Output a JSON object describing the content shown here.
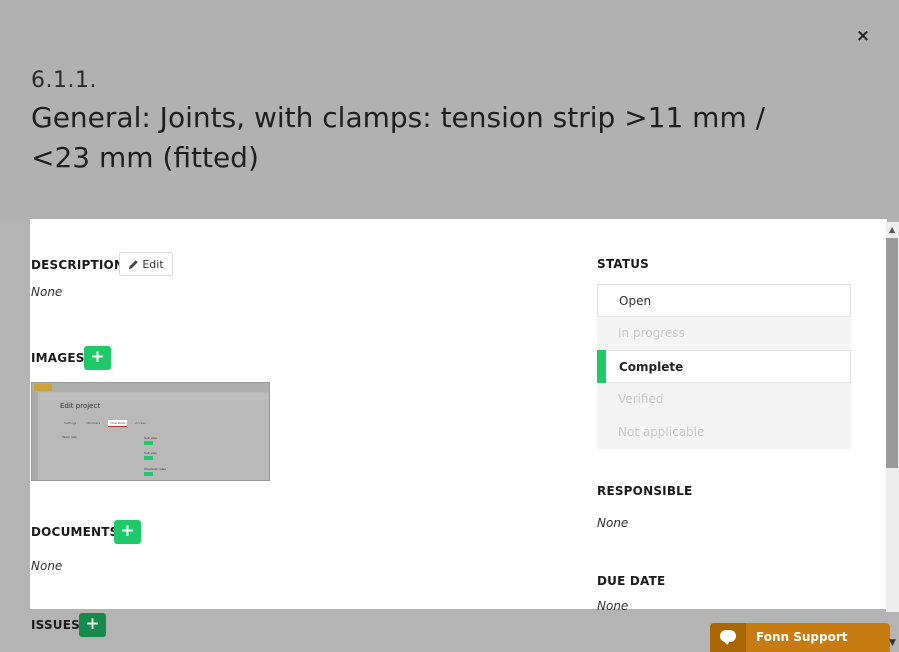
{
  "modal": {
    "number": "6.1.1.",
    "title_line1": "General: Joints, with clamps: tension strip >11 mm /",
    "title_line2": "<23 mm (fitted)",
    "close_glyph": "×"
  },
  "description": {
    "label": "DESCRIPTION",
    "edit_label": "Edit",
    "value": "None"
  },
  "images": {
    "label": "IMAGES",
    "add_glyph": "+"
  },
  "thumbnail": {
    "title": "Edit project",
    "tabs": [
      "Settings",
      "Members",
      "Checklists",
      "Access"
    ],
    "sections": [
      "Sub jobs",
      "Sub jobs",
      "Checklist rules"
    ],
    "left_label": "Team lists",
    "accent_color": "#1fc96a"
  },
  "documents": {
    "label": "DOCUMENTS",
    "add_glyph": "+",
    "value": "None"
  },
  "issues": {
    "label": "ISSUES",
    "add_glyph": "+"
  },
  "status": {
    "label": "STATUS",
    "items": [
      {
        "label": "Open",
        "state": "default"
      },
      {
        "label": "In progress",
        "state": "muted"
      },
      {
        "label": "Complete",
        "state": "active"
      },
      {
        "label": "Verified",
        "state": "muted"
      },
      {
        "label": "Not applicable",
        "state": "muted"
      }
    ],
    "active_color": "#1fc96a"
  },
  "responsible": {
    "label": "RESPONSIBLE",
    "value": "None"
  },
  "due_date": {
    "label": "DUE DATE",
    "value": "None"
  },
  "support": {
    "label": "Fonn Support",
    "color": "#c67c10"
  }
}
